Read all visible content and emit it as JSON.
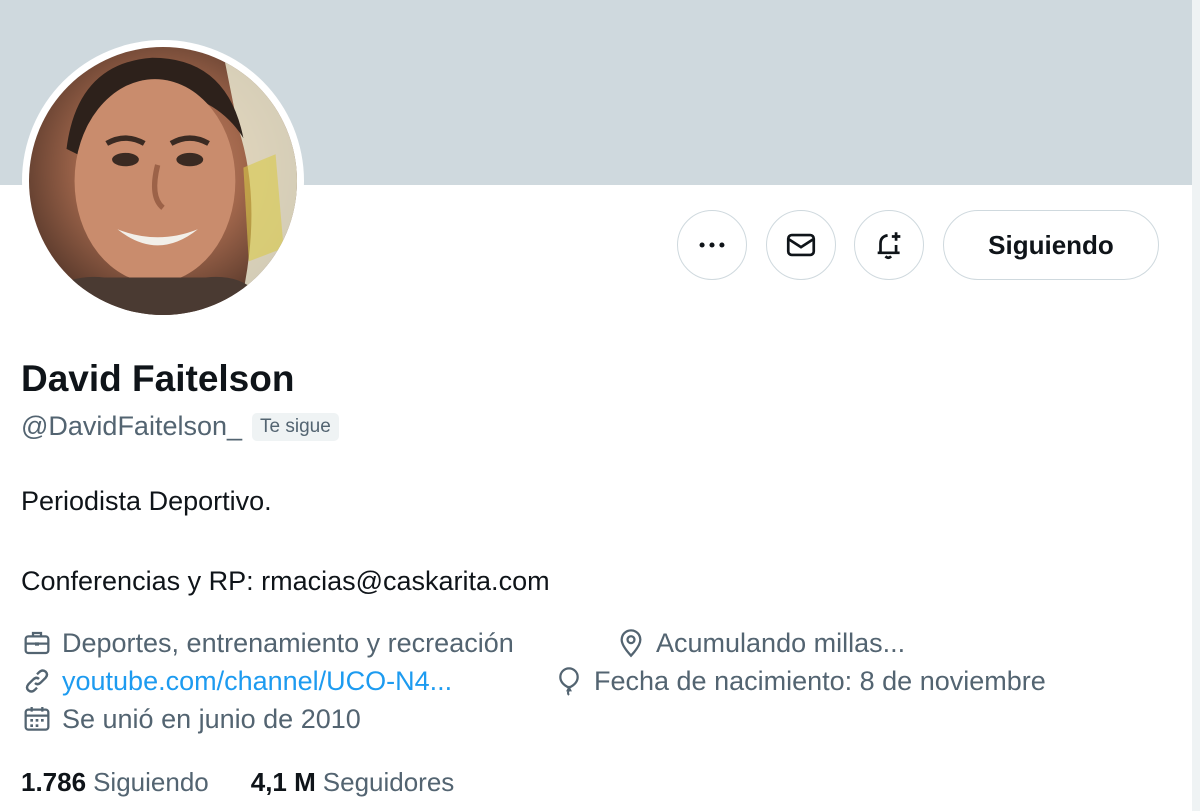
{
  "profile": {
    "name": "David Faitelson",
    "handle": "@DavidFaitelson_",
    "follows_you_badge": "Te sigue",
    "bio_line1": "Periodista Deportivo.",
    "bio_line2": "Conferencias y RP: rmacias@caskarita.com"
  },
  "actions": {
    "more_icon": "more-icon",
    "message_icon": "mail-icon",
    "notify_icon": "bell-plus-icon",
    "follow_label": "Siguiendo"
  },
  "meta": {
    "category": "Deportes, entrenamiento y recreación",
    "location": "Acumulando millas...",
    "url": "youtube.com/channel/UCO-N4...",
    "birthday": "Fecha de nacimiento: 8 de noviembre",
    "joined": "Se unió en junio de 2010"
  },
  "stats": {
    "following_count": "1.786",
    "following_label": "Siguiendo",
    "followers_count": "4,1 M",
    "followers_label": "Seguidores"
  },
  "colors": {
    "banner": "#cfd9de",
    "link": "#1d9bf0",
    "secondary_text": "#536471",
    "primary_text": "#0f1419"
  }
}
